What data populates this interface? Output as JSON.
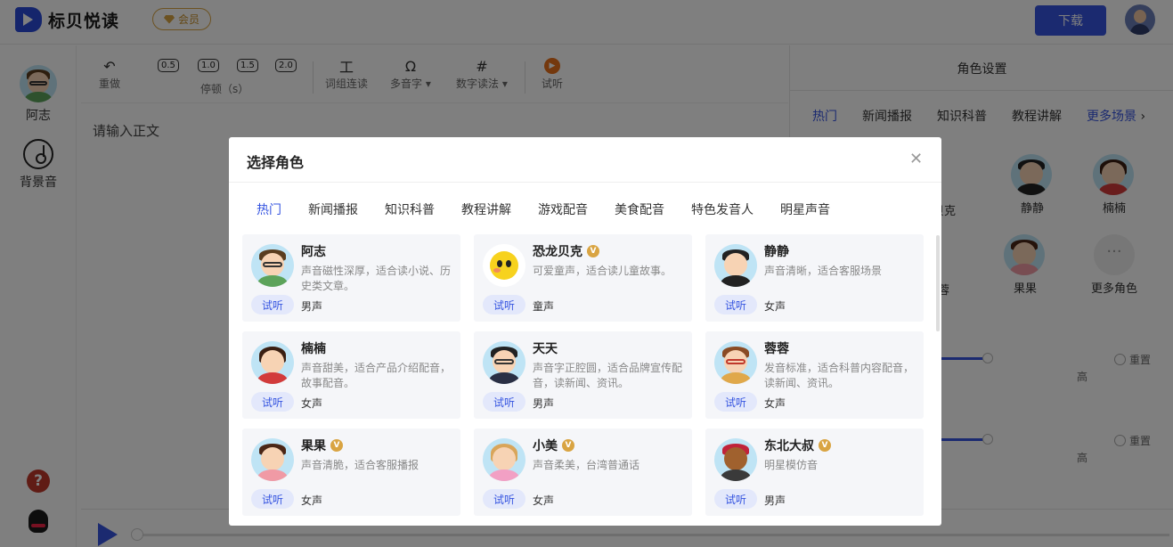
{
  "app": {
    "name": "标贝悦读",
    "vip_label": "会员",
    "download_label": "下载"
  },
  "sidebar": {
    "current_voice": "阿志",
    "bgm_label": "背景音"
  },
  "toolbar": {
    "undo": "重做",
    "pauses": [
      "0.5",
      "1.0",
      "1.5",
      "2.0"
    ],
    "pause_label": "停顿（s）",
    "word_link": "词组连读",
    "polyphone": "多音字",
    "number_read": "数字读法",
    "preview": "试听"
  },
  "editor": {
    "placeholder": "请输入正文"
  },
  "right_panel": {
    "title": "角色设置",
    "tabs": [
      "热门",
      "新闻播报",
      "知识科普",
      "教程讲解",
      "更多场景"
    ],
    "roles_row1": [
      "贝克",
      "静静",
      "楠楠"
    ],
    "roles_row2": [
      "蓉",
      "果果",
      "更多角色"
    ],
    "reset_label": "重置",
    "high_label": "高"
  },
  "modal": {
    "title": "选择角色",
    "tabs": [
      "热门",
      "新闻播报",
      "知识科普",
      "教程讲解",
      "游戏配音",
      "美食配音",
      "特色发音人",
      "明星声音"
    ],
    "try_label": "试听",
    "voices": [
      {
        "name": "阿志",
        "vip": false,
        "desc": "声音磁性深厚，适合读小说、历史类文章。",
        "gender": "男声"
      },
      {
        "name": "恐龙贝克",
        "vip": true,
        "desc": "可爱童声，适合读儿童故事。",
        "gender": "童声"
      },
      {
        "name": "静静",
        "vip": false,
        "desc": "声音清晰，适合客服场景",
        "gender": "女声"
      },
      {
        "name": "楠楠",
        "vip": false,
        "desc": "声音甜美，适合产品介绍配音，故事配音。",
        "gender": "女声"
      },
      {
        "name": "天天",
        "vip": false,
        "desc": "声音字正腔圆，适合品牌宣传配音，读新闻、资讯。",
        "gender": "男声"
      },
      {
        "name": "蓉蓉",
        "vip": false,
        "desc": "发音标准，适合科普内容配音，读新闻、资讯。",
        "gender": "女声"
      },
      {
        "name": "果果",
        "vip": true,
        "desc": "声音清脆，适合客服播报",
        "gender": "女声"
      },
      {
        "name": "小美",
        "vip": true,
        "desc": "声音柔美，台湾普通话",
        "gender": "女声"
      },
      {
        "name": "东北大叔",
        "vip": true,
        "desc": "明星模仿音",
        "gender": "男声"
      }
    ]
  },
  "colors": {
    "accent": "#3655e0",
    "vip_gold": "#d9a442"
  }
}
